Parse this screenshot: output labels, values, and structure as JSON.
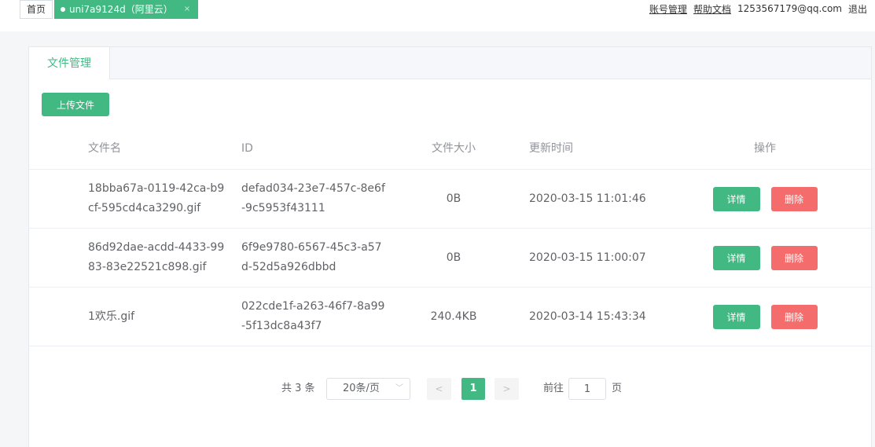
{
  "topbar": {
    "home_tab": "首页",
    "active_tab": "uni7a9124d（阿里云）",
    "active_tab_close": "×",
    "links": {
      "account": "账号管理",
      "help": "帮助文档",
      "email": "1253567179@qq.com",
      "logout": "退出"
    }
  },
  "card": {
    "tab_label": "文件管理",
    "upload_button": "上传文件"
  },
  "table": {
    "headers": {
      "name": "文件名",
      "id": "ID",
      "size": "文件大小",
      "time": "更新时间",
      "ops": "操作"
    },
    "rows": [
      {
        "name": "18bba67a-0119-42ca-b9cf-595cd4ca3290.gif",
        "id": "defad034-23e7-457c-8e6f-9c5953f43111",
        "size": "0B",
        "time": "2020-03-15 11:01:46",
        "detail": "详情",
        "delete": "删除"
      },
      {
        "name": "86d92dae-acdd-4433-9983-83e22521c898.gif",
        "id": "6f9e9780-6567-45c3-a57d-52d5a926dbbd",
        "size": "0B",
        "time": "2020-03-15 11:00:07",
        "detail": "详情",
        "delete": "删除"
      },
      {
        "name": "1欢乐.gif",
        "id": "022cde1f-a263-46f7-8a99-5f13dc8a43f7",
        "size": "240.4KB",
        "time": "2020-03-14 15:43:34",
        "detail": "详情",
        "delete": "删除"
      }
    ]
  },
  "pagination": {
    "total": "共 3 条",
    "page_size": "20条/页",
    "current_page": "1",
    "goto_label": "前往",
    "goto_value": "1",
    "page_suffix": "页",
    "prev_icon": "chevron-left-icon",
    "next_icon": "chevron-right-icon"
  },
  "colors": {
    "primary": "#42b983",
    "danger": "#f56c6c"
  }
}
